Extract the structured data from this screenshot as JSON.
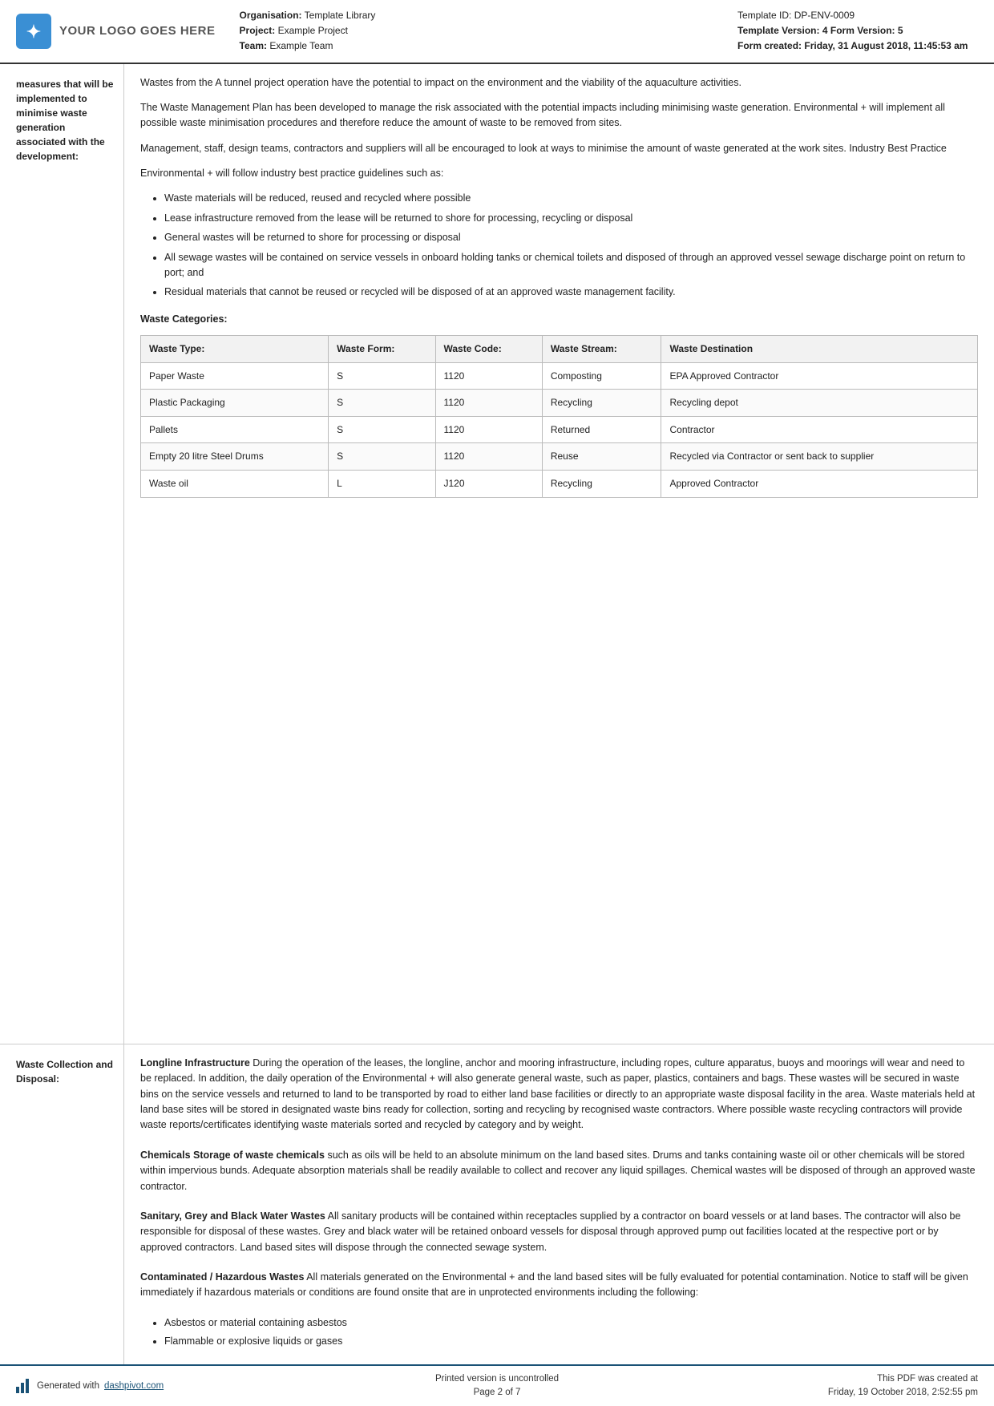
{
  "header": {
    "logo_text": "YOUR LOGO GOES HERE",
    "org_label": "Organisation:",
    "org_value": "Template Library",
    "project_label": "Project:",
    "project_value": "Example Project",
    "team_label": "Team:",
    "team_value": "Example Team",
    "template_id_label": "Template ID:",
    "template_id_value": "DP-ENV-0009",
    "template_version_label": "Template Version:",
    "template_version_value": "4",
    "form_version_label": "Form Version:",
    "form_version_value": "5",
    "form_created_label": "Form created:",
    "form_created_value": "Friday, 31 August 2018, 11:45:53 am"
  },
  "left_col": {
    "label": "measures that will be implemented to minimise waste generation associated with the development:"
  },
  "body": {
    "para1": "Wastes from the A tunnel project operation have the potential to impact on the environment and the viability of the aquaculture activities.",
    "para2": "The Waste Management Plan has been developed to manage the risk associated with the potential impacts including minimising waste generation. Environmental + will implement all possible waste minimisation procedures and therefore reduce the amount of waste to be removed from sites.",
    "para3": "Management, staff, design teams, contractors and suppliers will all be encouraged to look at ways to minimise the amount of waste generated at the work sites. Industry Best Practice",
    "para4": "Environmental + will follow industry best practice guidelines such as:",
    "bullets": [
      "Waste materials will be reduced, reused and recycled where possible",
      "Lease infrastructure removed from the lease will be returned to shore for processing, recycling or disposal",
      "General wastes will be returned to shore for processing or disposal",
      "All sewage wastes will be contained on service vessels in onboard holding tanks or chemical toilets and disposed of through an approved vessel sewage discharge point on return to port; and",
      "Residual materials that cannot be reused or recycled will be disposed of at an approved waste management facility."
    ]
  },
  "waste_categories": {
    "heading": "Waste Categories:",
    "table": {
      "headers": [
        "Waste Type:",
        "Waste Form:",
        "Waste Code:",
        "Waste Stream:",
        "Waste Destination"
      ],
      "rows": [
        [
          "Paper Waste",
          "S",
          "1120",
          "Composting",
          "EPA Approved Contractor"
        ],
        [
          "Plastic Packaging",
          "S",
          "1120",
          "Recycling",
          "Recycling depot"
        ],
        [
          "Pallets",
          "S",
          "1120",
          "Returned",
          "Contractor"
        ],
        [
          "Empty 20 litre Steel Drums",
          "S",
          "1120",
          "Reuse",
          "Recycled via Contractor or sent back to supplier"
        ],
        [
          "Waste oil",
          "L",
          "J120",
          "Recycling",
          "Approved Contractor"
        ]
      ]
    }
  },
  "waste_collection": {
    "label": "Waste Collection and Disposal:",
    "sections": [
      {
        "bold_part": "Longline Infrastructure",
        "text": " During the operation of the leases, the longline, anchor and mooring infrastructure, including ropes, culture apparatus, buoys and moorings will wear and need to be replaced. In addition, the daily operation of the Environmental + will also generate general waste, such as paper, plastics, containers and bags. These wastes will be secured in waste bins on the service vessels and returned to land to be transported by road to either land base facilities or directly to an appropriate waste disposal facility in the area. Waste materials held at land base sites will be stored in designated waste bins ready for collection, sorting and recycling by recognised waste contractors. Where possible waste recycling contractors will provide waste reports/certificates identifying waste materials sorted and recycled by category and by weight."
      },
      {
        "bold_part": "Chemicals Storage of waste chemicals",
        "text": " such as oils will be held to an absolute minimum on the land based sites. Drums and tanks containing waste oil or other chemicals will be stored within impervious bunds. Adequate absorption materials shall be readily available to collect and recover any liquid spillages. Chemical wastes will be disposed of through an approved waste contractor."
      },
      {
        "bold_part": "Sanitary, Grey and Black Water Wastes",
        "text": " All sanitary products will be contained within receptacles supplied by a contractor on board vessels or at land bases. The contractor will also be responsible for disposal of these wastes. Grey and black water will be retained onboard vessels for disposal through approved pump out facilities located at the respective port or by approved contractors. Land based sites will dispose through the connected sewage system."
      },
      {
        "bold_part": "Contaminated / Hazardous Wastes",
        "text": " All materials generated on the Environmental + and the land based sites will be fully evaluated for potential contamination. Notice to staff will be given immediately if hazardous materials or conditions are found onsite that are in unprotected environments including the following:",
        "bullets": [
          "Asbestos or material containing asbestos",
          "Flammable or explosive liquids or gases"
        ]
      }
    ]
  },
  "footer": {
    "generated_text": "Generated with",
    "link_text": "dashpivot.com",
    "center_line1": "Printed version is uncontrolled",
    "center_line2": "Page 2 of 7",
    "right_line1": "This PDF was created at",
    "right_line2": "Friday, 19 October 2018, 2:52:55 pm"
  }
}
